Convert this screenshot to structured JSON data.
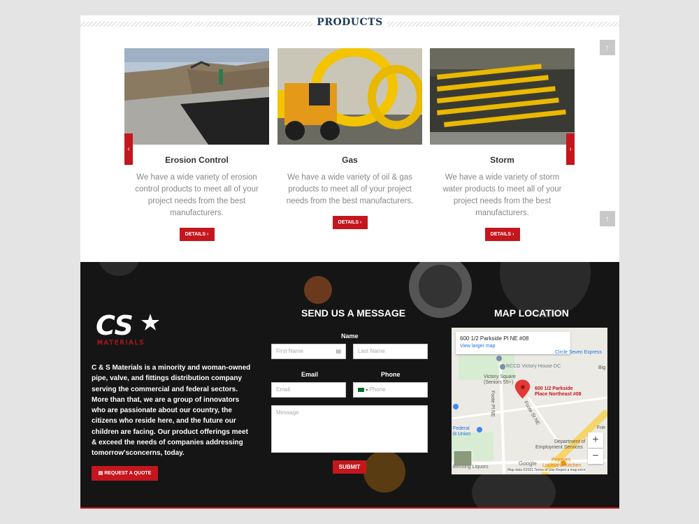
{
  "products": {
    "title": "PRODUCTS",
    "details_label": "DETAILS",
    "cards": [
      {
        "title": "Erosion Control",
        "text": "We have a wide variety of erosion control products to meet all of your project needs from the best manufacturers."
      },
      {
        "title": "Gas",
        "text": "We have a wide variety of oil & gas products to meet all of your project needs from the best manufacturers."
      },
      {
        "title": "Storm",
        "text": "We have a wide variety of storm water products to meet all of your project needs from the best manufacturers."
      }
    ]
  },
  "footer": {
    "logo_text": "CS",
    "logo_sub": "MATERIALS",
    "about": "C & S Materials is a minority and woman-owned pipe, valve, and fittings distribution company serving the commercial and federal sectors. More than that, we are a group of innovators who are passionate about our country, the citizens who reside here, and the future our children are facing. Our product offerings meet & exceed the needs of companies addressing tomorrow'sconcerns, today.",
    "quote_label": "REQUEST A QUOTE",
    "form": {
      "title": "SEND US A MESSAGE",
      "name_label": "Name",
      "first_placeholder": "First Name",
      "last_placeholder": "Last Name",
      "email_label": "Email",
      "phone_label": "Phone",
      "email_placeholder": "Email",
      "phone_placeholder": "Phone",
      "message_placeholder": "Message",
      "submit_label": "SUBMIT"
    },
    "map": {
      "title": "MAP LOCATION",
      "address": "600 1/2 Parkside Pl NE #08",
      "larger_link": "View larger map",
      "pin_label_1": "600 1/2 Parkside",
      "pin_label_2": "Place Northeast #08",
      "places": [
        "Circle Seven Express",
        "RCCG Victory House DC",
        "Victory Square",
        "(Seniors 55+)",
        "Federal",
        "lit Union",
        "Department of",
        "Employment Services",
        "Popeyes",
        "Louisiana Kitchen",
        "Benning Liquors",
        "Big",
        "Frie",
        "Foote Pl NE",
        "Foote St NE"
      ],
      "zoom_in": "+",
      "zoom_out": "−",
      "attribution": "Map data ©2021    Terms of Use    Report a map error",
      "google": "Google"
    }
  },
  "colors": {
    "accent": "#c5161d",
    "title": "#1f3a5a",
    "footer_bg": "#151515"
  }
}
